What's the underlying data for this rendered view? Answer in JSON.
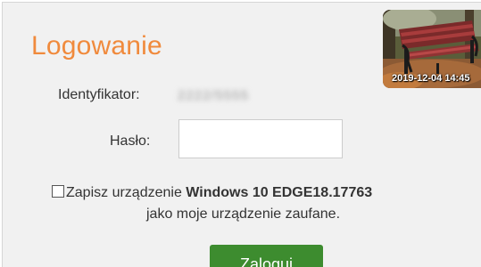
{
  "login": {
    "title": "Logowanie",
    "photo_timestamp": "2019-12-04 14:45",
    "identifier_label": "Identyfikator:",
    "identifier_value": "2222/5555",
    "password_label": "Hasło:",
    "password_value": "",
    "remember_prefix": "Zapisz urządzenie",
    "device_name": "Windows 10 EDGE18.17763",
    "remember_suffix": "jako moje urządzenie zaufane.",
    "remember_checked": false,
    "submit_label": "Zaloguj"
  },
  "colors": {
    "title": "#f08a3c",
    "button": "#3d8c2f",
    "panel": "#f1f1f1"
  }
}
